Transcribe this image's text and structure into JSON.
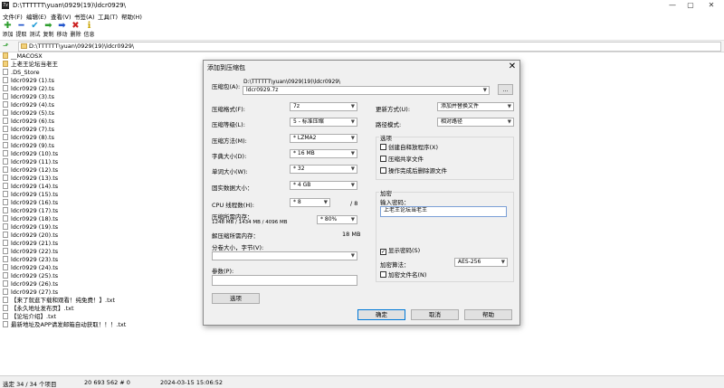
{
  "app": {
    "title": "D:\\TTTTTT\\yuan\\0929(19)\\ldcr0929\\",
    "controls": {
      "minimize": "—",
      "maximize": "▢",
      "close": "✕"
    }
  },
  "menu": [
    "文件(F)",
    "编辑(E)",
    "查看(V)",
    "书签(A)",
    "工具(T)",
    "帮助(H)"
  ],
  "toolbar": [
    {
      "label": "添加",
      "glyph": "✚",
      "color": "#2e9e2e",
      "icon": "add-icon"
    },
    {
      "label": "提取",
      "glyph": "━",
      "color": "#2255cc",
      "icon": "extract-icon"
    },
    {
      "label": "测试",
      "glyph": "✔",
      "color": "#1e9bd7",
      "icon": "test-icon"
    },
    {
      "label": "复制",
      "glyph": "➡",
      "color": "#2e9e2e",
      "icon": "copy-icon"
    },
    {
      "label": "移动",
      "glyph": "➡",
      "color": "#2255cc",
      "icon": "move-icon"
    },
    {
      "label": "删除",
      "glyph": "✖",
      "color": "#cc2222",
      "icon": "delete-icon"
    },
    {
      "label": "信息",
      "glyph": "ℹ",
      "color": "#c9a400",
      "icon": "info-icon"
    }
  ],
  "address": "D:\\TTTTTT\\yuan\\0929(19)\\ldcr0929\\",
  "files": [
    {
      "name": "__MACOSX",
      "type": "folder"
    },
    {
      "name": "上老王论坛当老王",
      "type": "folder"
    },
    {
      "name": ".DS_Store",
      "type": "file"
    },
    {
      "name": "ldcr0929 (1).ts",
      "type": "file"
    },
    {
      "name": "ldcr0929 (2).ts",
      "type": "file"
    },
    {
      "name": "ldcr0929 (3).ts",
      "type": "file"
    },
    {
      "name": "ldcr0929 (4).ts",
      "type": "file"
    },
    {
      "name": "ldcr0929 (5).ts",
      "type": "file"
    },
    {
      "name": "ldcr0929 (6).ts",
      "type": "file"
    },
    {
      "name": "ldcr0929 (7).ts",
      "type": "file"
    },
    {
      "name": "ldcr0929 (8).ts",
      "type": "file"
    },
    {
      "name": "ldcr0929 (9).ts",
      "type": "file"
    },
    {
      "name": "ldcr0929 (10).ts",
      "type": "file"
    },
    {
      "name": "ldcr0929 (11).ts",
      "type": "file"
    },
    {
      "name": "ldcr0929 (12).ts",
      "type": "file"
    },
    {
      "name": "ldcr0929 (13).ts",
      "type": "file"
    },
    {
      "name": "ldcr0929 (14).ts",
      "type": "file"
    },
    {
      "name": "ldcr0929 (15).ts",
      "type": "file"
    },
    {
      "name": "ldcr0929 (16).ts",
      "type": "file"
    },
    {
      "name": "ldcr0929 (17).ts",
      "type": "file"
    },
    {
      "name": "ldcr0929 (18).ts",
      "type": "file"
    },
    {
      "name": "ldcr0929 (19).ts",
      "type": "file"
    },
    {
      "name": "ldcr0929 (20).ts",
      "type": "file"
    },
    {
      "name": "ldcr0929 (21).ts",
      "type": "file"
    },
    {
      "name": "ldcr0929 (22).ts",
      "type": "file"
    },
    {
      "name": "ldcr0929 (23).ts",
      "type": "file"
    },
    {
      "name": "ldcr0929 (24).ts",
      "type": "file"
    },
    {
      "name": "ldcr0929 (25).ts",
      "type": "file"
    },
    {
      "name": "ldcr0929 (26).ts",
      "type": "file"
    },
    {
      "name": "ldcr0929 (27).ts",
      "type": "file"
    },
    {
      "name": "【来了就逛下载和观看！纯免费！】.txt",
      "type": "file"
    },
    {
      "name": "【永久地址发布页】.txt",
      "type": "file"
    },
    {
      "name": "【论坛介绍】.txt",
      "type": "file"
    },
    {
      "name": "最新地址及APP请发邮箱自动获取！！！.txt",
      "type": "file"
    }
  ],
  "status": {
    "selection": "选定 34 / 34 个项目",
    "size": "20 693 562 # 0",
    "date": "2024-03-15 15:06:52"
  },
  "dialog": {
    "title": "添加到压缩包",
    "archive_label": "压缩包(A):",
    "archive_path": "D:\\TTTTTT\\yuan\\0929(19)\\ldcr0929\\",
    "archive_name": "ldcr0929.7z",
    "browse": "...",
    "format_label": "压缩格式(F):",
    "format_value": "7z",
    "level_label": "压缩等级(L):",
    "level_value": "5 - 标准压缩",
    "method_label": "压缩方法(M):",
    "method_value": "* LZMA2",
    "dict_label": "字典大小(D):",
    "dict_value": "* 16 MB",
    "word_label": "单词大小(W):",
    "word_value": "* 32",
    "solid_label": "固实数据大小：",
    "solid_value": "* 4 GB",
    "threads_label": "CPU 线程数(H):",
    "threads_value": "* 8",
    "threads_total": "/ 8",
    "memory_label": "压缩所需内存：",
    "memory_detail": "1248 MB / 1434 MB / 4096 MB",
    "memory_value": "* 80%",
    "decomp_label": "解压缩所需内存：",
    "decomp_value": "18 MB",
    "split_label": "分卷大小，字节(V):",
    "split_value": "",
    "params_label": "参数(P):",
    "params_value": "",
    "options_button": "选项",
    "update_label": "更新方式(U):",
    "update_value": "添加并替换文件",
    "pathmode_label": "路径模式:",
    "pathmode_value": "相对路径",
    "options_group": "选项",
    "opt_sfx": "创建自释放程序(X)",
    "opt_shared": "压缩共享文件",
    "opt_delete": "操作完成后删除源文件",
    "encrypt_group": "加密",
    "password_label": "输入密码：",
    "password_value": "上老王论坛当老王",
    "show_password": "显示密码(S)",
    "show_password_checked": true,
    "enc_method_label": "加密算法：",
    "enc_method_value": "AES-256",
    "encrypt_names": "加密文件名(N)",
    "ok": "确定",
    "cancel": "取消",
    "help": "帮助"
  }
}
